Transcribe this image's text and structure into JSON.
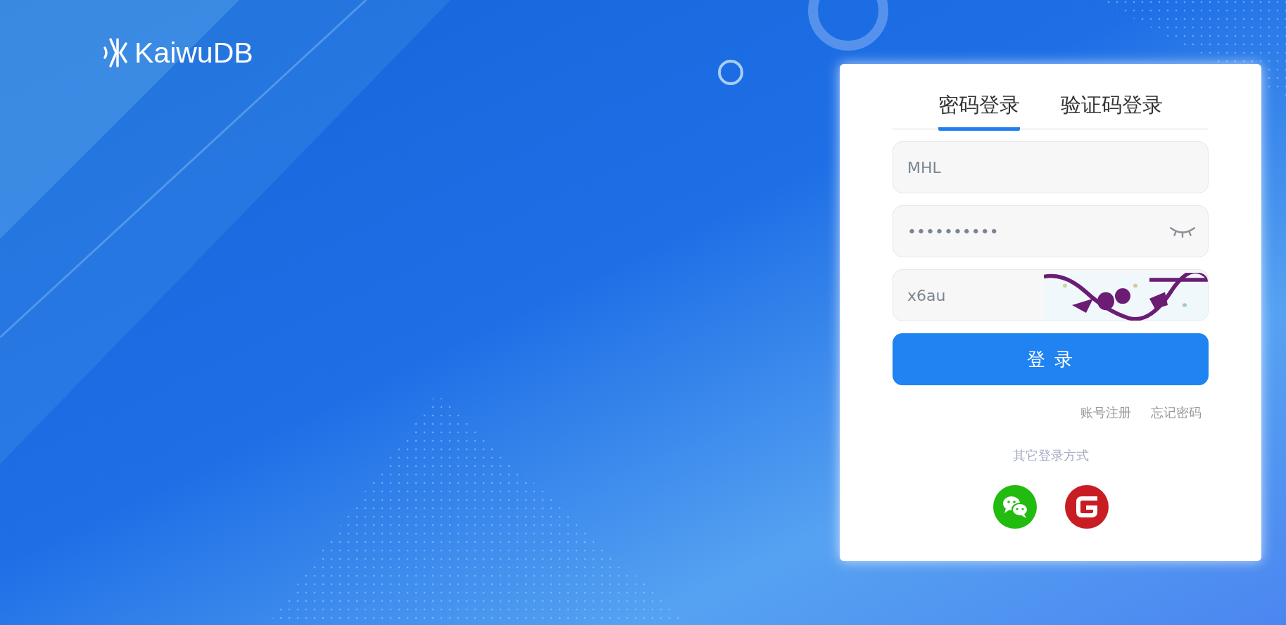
{
  "logo": {
    "text": "KaiwuDB"
  },
  "tabs": [
    {
      "label": "密码登录",
      "selected": true
    },
    {
      "label": "验证码登录",
      "selected": false
    }
  ],
  "username": {
    "value": "MHL"
  },
  "password": {
    "value": "••••••••••"
  },
  "captcha": {
    "value": "x6au"
  },
  "login_button": "登 录",
  "links": [
    "账号注册",
    "忘记密码"
  ],
  "other_methods": {
    "label": "其它登录方式",
    "options": [
      {
        "kind": "wechat"
      },
      {
        "kind": "gitee"
      }
    ]
  }
}
